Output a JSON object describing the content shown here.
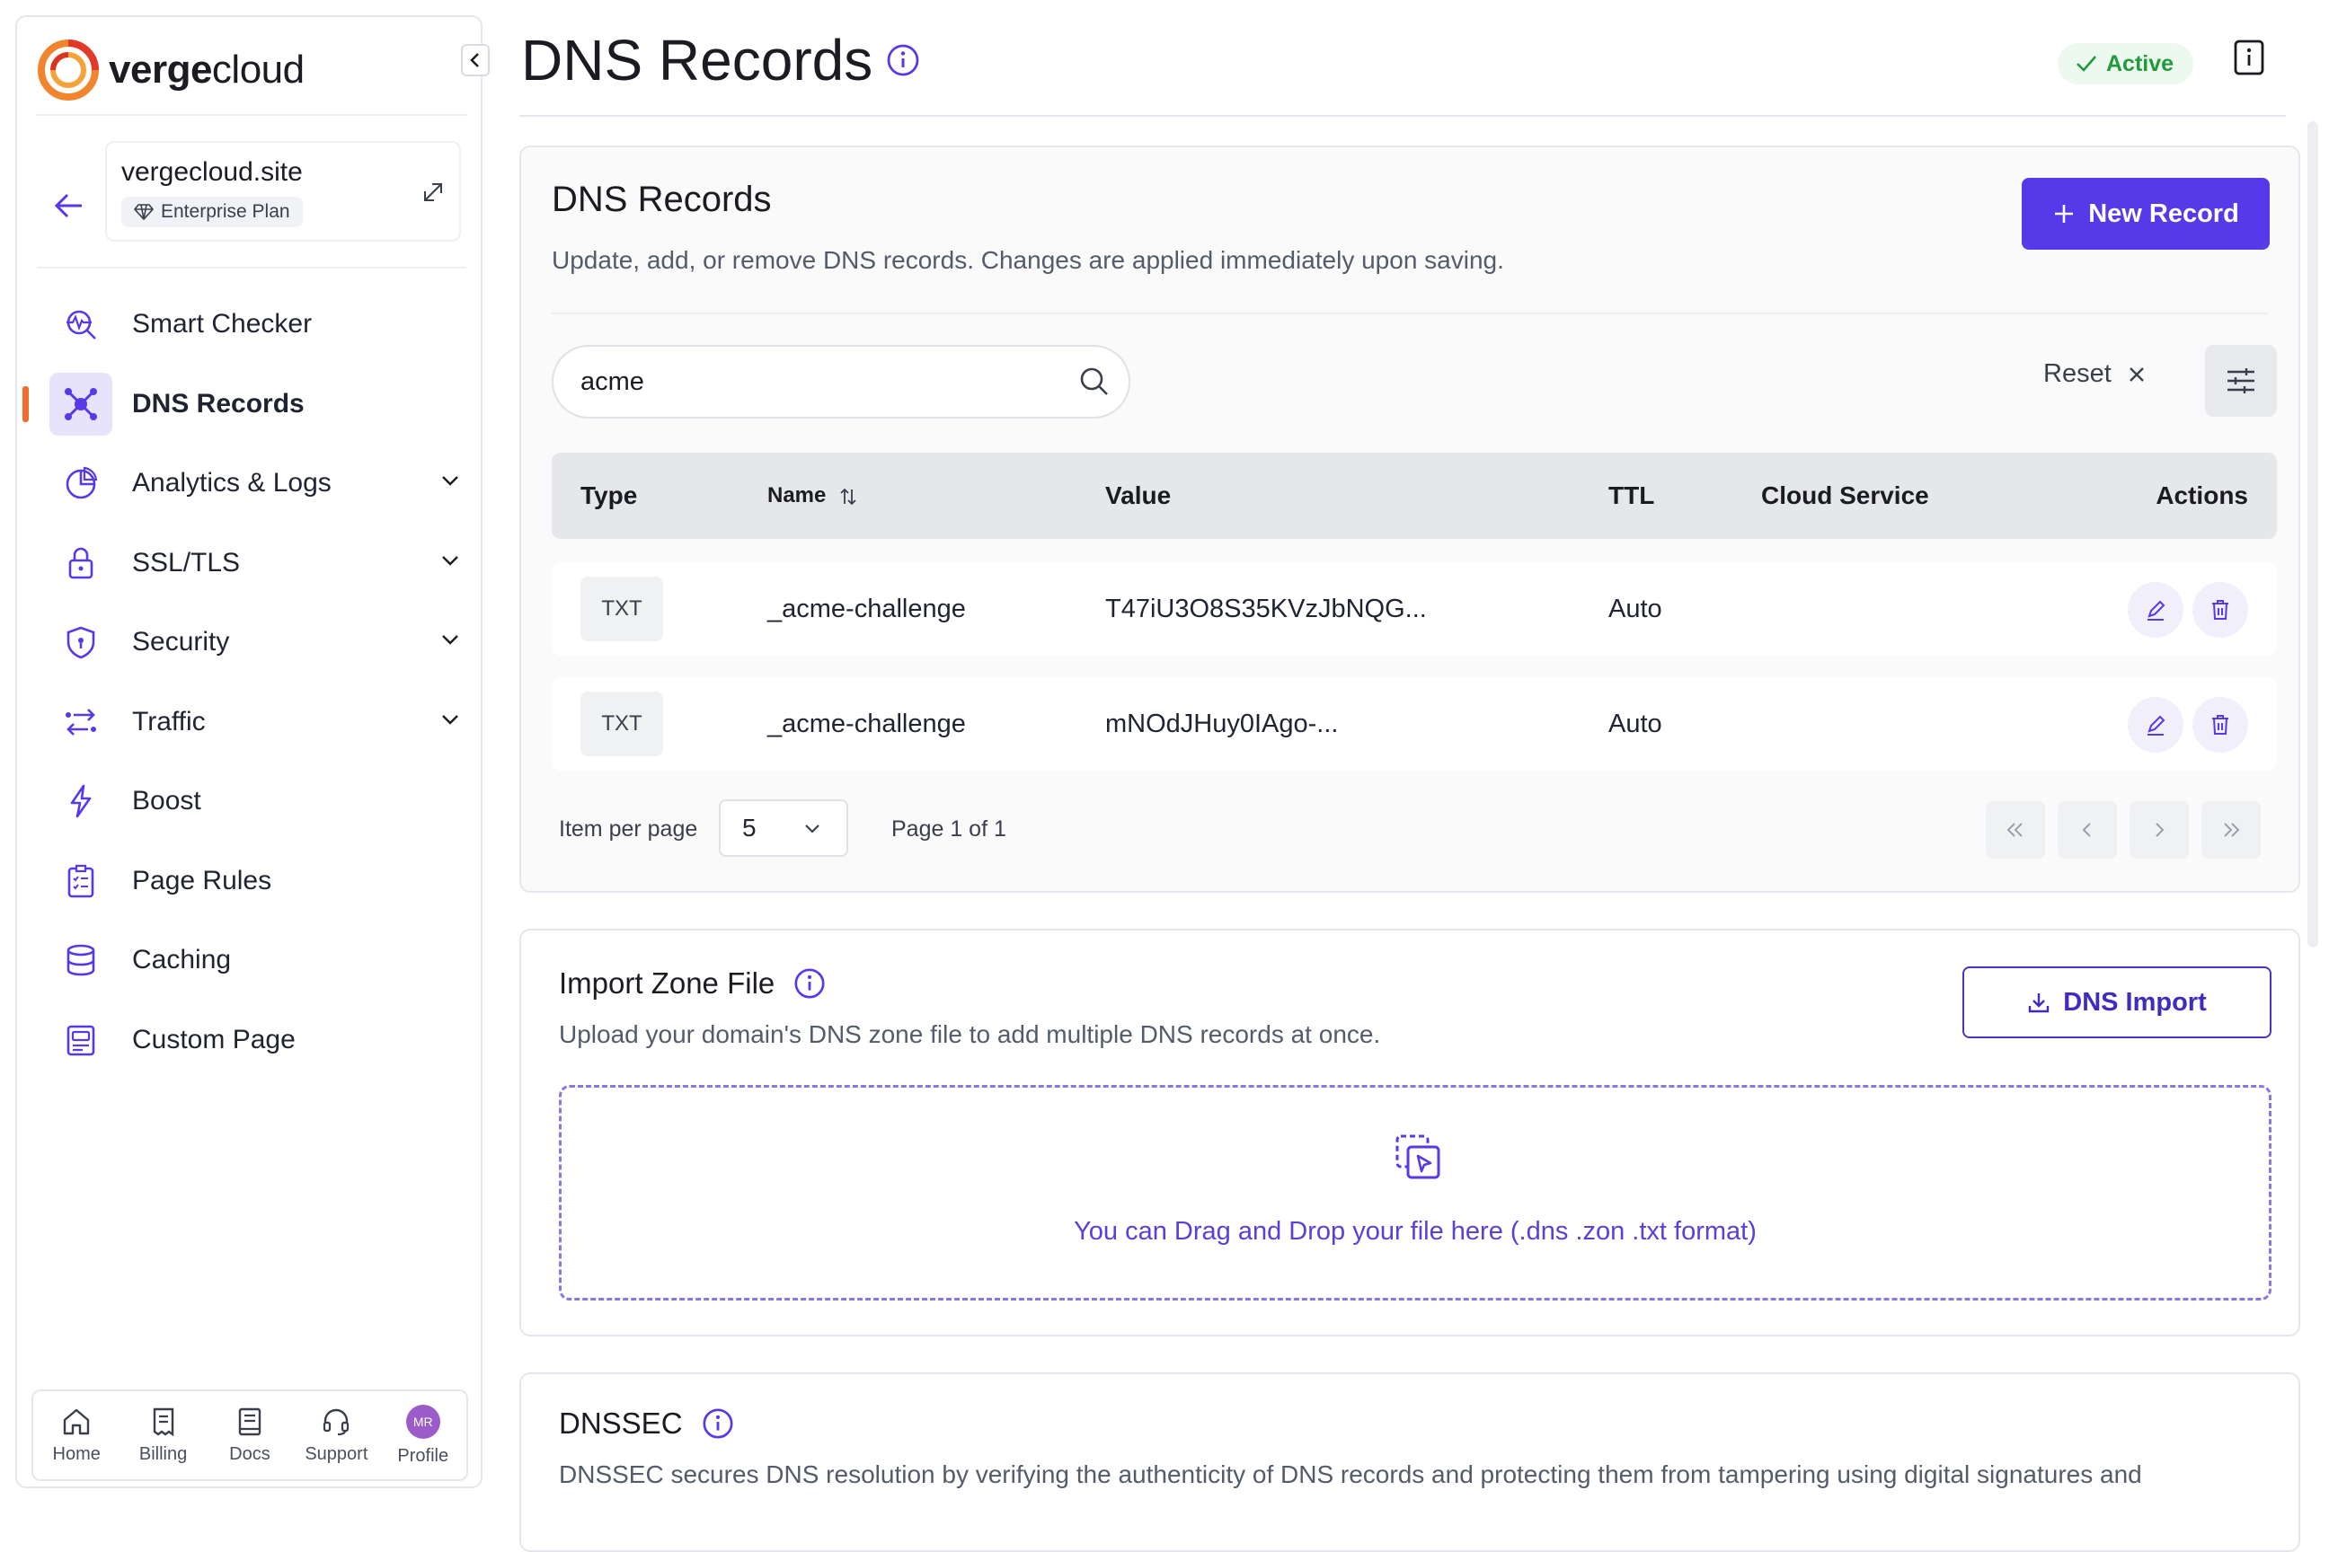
{
  "brand": {
    "name_bold": "verge",
    "name_rest": "cloud"
  },
  "site": {
    "domain": "vergecloud.site",
    "plan": "Enterprise Plan"
  },
  "nav": {
    "items": [
      {
        "label": "Smart Checker",
        "icon": "smart-checker-icon",
        "active": false,
        "expandable": false
      },
      {
        "label": "DNS Records",
        "icon": "dns-records-icon",
        "active": true,
        "expandable": false
      },
      {
        "label": "Analytics & Logs",
        "icon": "analytics-icon",
        "active": false,
        "expandable": true
      },
      {
        "label": "SSL/TLS",
        "icon": "lock-icon",
        "active": false,
        "expandable": true
      },
      {
        "label": "Security",
        "icon": "shield-icon",
        "active": false,
        "expandable": true
      },
      {
        "label": "Traffic",
        "icon": "traffic-icon",
        "active": false,
        "expandable": true
      },
      {
        "label": "Boost",
        "icon": "bolt-icon",
        "active": false,
        "expandable": false
      },
      {
        "label": "Page Rules",
        "icon": "page-rules-icon",
        "active": false,
        "expandable": false
      },
      {
        "label": "Caching",
        "icon": "database-icon",
        "active": false,
        "expandable": false
      },
      {
        "label": "Custom Page",
        "icon": "custom-page-icon",
        "active": false,
        "expandable": false
      }
    ]
  },
  "bottom_bar": {
    "items": [
      {
        "label": "Home",
        "icon": "home-icon"
      },
      {
        "label": "Billing",
        "icon": "receipt-icon"
      },
      {
        "label": "Docs",
        "icon": "book-icon"
      },
      {
        "label": "Support",
        "icon": "headset-icon"
      },
      {
        "label": "Profile",
        "icon": "avatar",
        "initials": "MR"
      }
    ]
  },
  "header": {
    "title": "DNS Records",
    "status": "Active"
  },
  "dns_card": {
    "title": "DNS Records",
    "subtitle": "Update, add, or remove DNS records. Changes are applied immediately upon saving.",
    "new_record_label": "New Record",
    "search_value": "acme",
    "search_placeholder": "Search",
    "reset_label": "Reset",
    "columns": [
      "Type",
      "Name",
      "Value",
      "TTL",
      "Cloud Service",
      "Actions"
    ],
    "rows": [
      {
        "type": "TXT",
        "name": "_acme-challenge",
        "value": "T47iU3O8S35KVzJbNQG...",
        "ttl": "Auto",
        "cloud_service": ""
      },
      {
        "type": "TXT",
        "name": "_acme-challenge",
        "value": "mNOdJHuy0IAgo-...",
        "ttl": "Auto",
        "cloud_service": ""
      }
    ],
    "items_per_page_label": "Item per page",
    "items_per_page": "5",
    "page_info": "Page 1 of 1"
  },
  "import_card": {
    "title": "Import Zone File",
    "subtitle": "Upload your domain's DNS zone file to add multiple DNS records at once.",
    "button_label": "DNS Import",
    "dropzone_text": "You can Drag and Drop your file here (.dns .zon .txt format)"
  },
  "dnssec_card": {
    "title": "DNSSEC",
    "subtitle": "DNSSEC secures DNS resolution by verifying the authenticity of DNS records and protecting them from tampering using digital signatures and"
  },
  "colors": {
    "accent": "#5639e8",
    "active_marker": "#f26b2f",
    "status_green": "#1f9b3c"
  }
}
